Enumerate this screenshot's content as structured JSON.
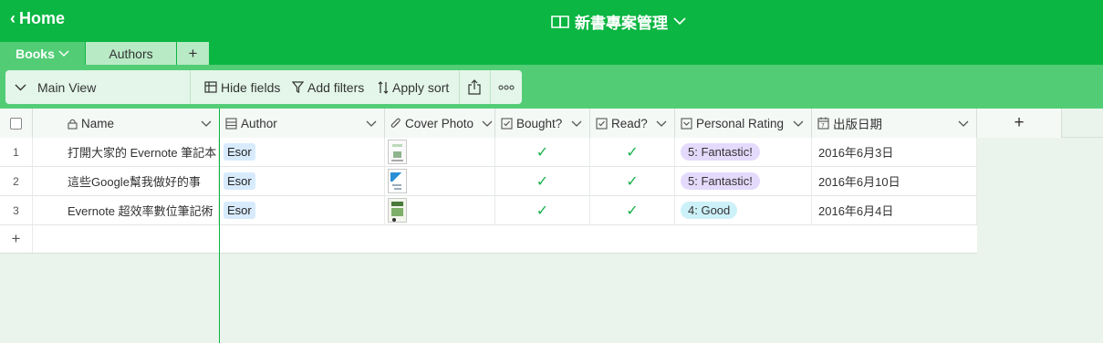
{
  "header": {
    "home_label": "Home",
    "base_title": "新書專案管理"
  },
  "tabs": [
    {
      "label": "Books"
    },
    {
      "label": "Authors"
    },
    {
      "label": "+"
    }
  ],
  "toolbar": {
    "view_name": "Main View",
    "hide_fields": "Hide fields",
    "add_filters": "Add filters",
    "apply_sort": "Apply sort"
  },
  "columns": [
    {
      "label": "Name",
      "icon": "lock-icon"
    },
    {
      "label": "Author",
      "icon": "link-icon"
    },
    {
      "label": "Cover Photo",
      "icon": "paperclip-icon"
    },
    {
      "label": "Bought?",
      "icon": "checkbox-icon"
    },
    {
      "label": "Read?",
      "icon": "checkbox-icon"
    },
    {
      "label": "Personal Rating",
      "icon": "select-icon"
    },
    {
      "label": "出版日期",
      "icon": "calendar-icon"
    }
  ],
  "add_column_label": "+",
  "add_row_label": "+",
  "rows": [
    {
      "num": "1",
      "name": "打開大家的 Evernote 筆記本",
      "author": "Esor",
      "bought": "✓",
      "read": "✓",
      "rating": "5: Fantastic!",
      "rating_color": "#e4dafc",
      "date": "2016年6月3日"
    },
    {
      "num": "2",
      "name": "這些Google幫我做好的事",
      "author": "Esor",
      "bought": "✓",
      "read": "✓",
      "rating": "5: Fantastic!",
      "rating_color": "#e4dafc",
      "date": "2016年6月10日"
    },
    {
      "num": "3",
      "name": "Evernote 超效率數位筆記術",
      "author": "Esor",
      "bought": "✓",
      "read": "✓",
      "rating": "4: Good",
      "rating_color": "#cdf1f9",
      "date": "2016年6月4日"
    }
  ],
  "colors": {
    "brand": "#0bb642",
    "view_bar": "#52cd76",
    "check": "#18b24a"
  }
}
